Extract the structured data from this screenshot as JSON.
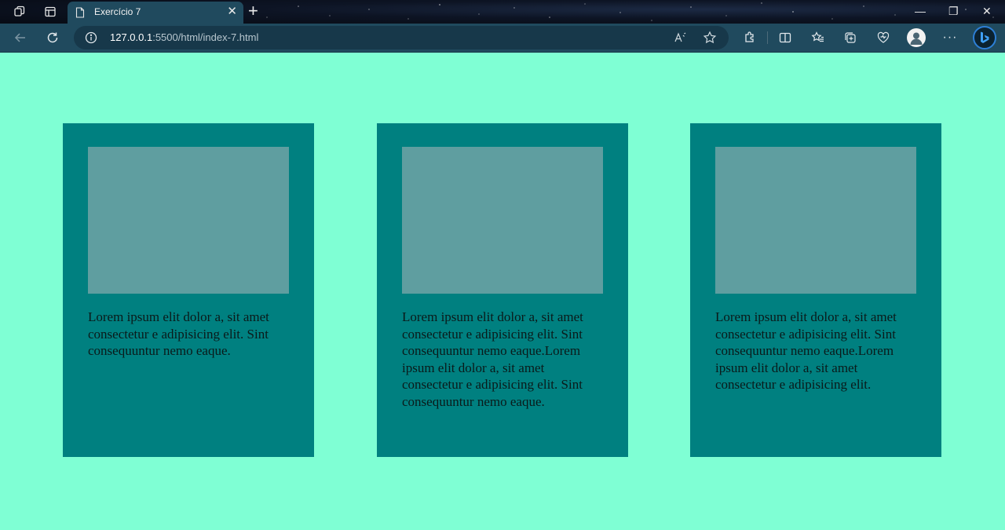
{
  "browser": {
    "tab_title": "Exercício 7",
    "url_host": "127.0.0.1",
    "url_rest": ":5500/html/index-7.html",
    "tab_close": "✕",
    "new_tab": "+",
    "window_controls": {
      "minimize": "—",
      "restore": "❐",
      "close": "✕"
    },
    "menu": "···"
  },
  "cards": [
    {
      "text": "Lorem ipsum elit dolor a, sit amet consectetur e adipisicing elit. Sint consequuntur nemo eaque."
    },
    {
      "text": "Lorem ipsum elit dolor a, sit amet consectetur e adipisicing elit. Sint consequuntur nemo eaque.Lorem ipsum elit dolor a, sit amet consectetur e adipisicing elit. Sint consequuntur nemo eaque."
    },
    {
      "text": "Lorem ipsum elit dolor a, sit amet consectetur e adipisicing elit. Sint consequuntur nemo eaque.Lorem ipsum elit dolor a, sit amet consectetur e adipisicing elit."
    }
  ],
  "colors": {
    "page_background": "#7fffd4",
    "card_background": "#008080",
    "image_placeholder": "#5f9ea0"
  }
}
